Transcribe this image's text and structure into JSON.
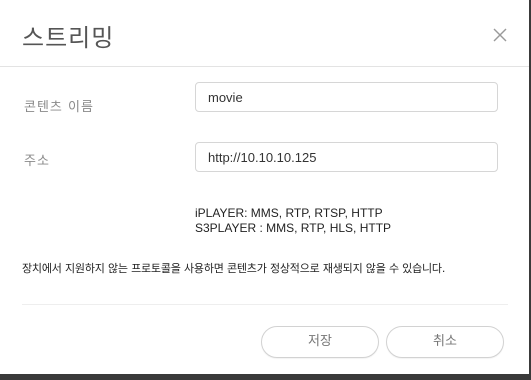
{
  "dialog": {
    "title": "스트리밍",
    "close_icon": "close-icon"
  },
  "form": {
    "name_label": "콘텐츠 이름",
    "name_value": "movie",
    "address_label": "주소",
    "address_value": "http://10.10.10.125"
  },
  "players": {
    "iplayer": "iPLAYER: MMS, RTP, RTSP, HTTP",
    "s3player": "S3PLAYER : MMS, RTP, HLS, HTTP"
  },
  "notice": "장치에서 지원하지 않는 프로토콜을 사용하면 콘텐츠가 정상적으로 재생되지 않을 수 있습니다.",
  "buttons": {
    "save": "저장",
    "cancel": "취소"
  },
  "colors": {
    "title": "#555555",
    "label": "#8a8a8a",
    "border": "#d6d6d6"
  }
}
